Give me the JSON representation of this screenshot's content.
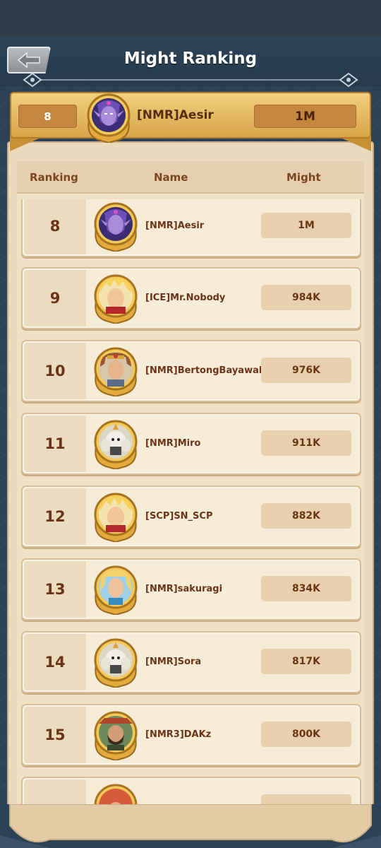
{
  "header": {
    "title": "Might Ranking",
    "back_icon": "arrow-left-icon"
  },
  "self": {
    "rank": "8",
    "name": "[NMR]Aesir",
    "might": "1M",
    "avatar": "elf-sorceress-avatar"
  },
  "columns": {
    "ranking": "Ranking",
    "name": "Name",
    "might": "Might"
  },
  "rows": [
    {
      "rank": "8",
      "name": "[NMR]Aesir",
      "might": "1M",
      "avatar": "elf-sorceress-avatar"
    },
    {
      "rank": "9",
      "name": "[ICE]Mr.Nobody",
      "might": "984K",
      "avatar": "blond-hero-avatar"
    },
    {
      "rank": "10",
      "name": "[NMR]BertongBayawak",
      "might": "976K",
      "avatar": "warrior-king-avatar"
    },
    {
      "rank": "11",
      "name": "[NMR]Miro",
      "might": "911K",
      "avatar": "white-knight-avatar"
    },
    {
      "rank": "12",
      "name": "[SCP]SN_SCP",
      "might": "882K",
      "avatar": "blond-hero-avatar"
    },
    {
      "rank": "13",
      "name": "[NMR]sakuragi",
      "might": "834K",
      "avatar": "long-hair-hero-avatar"
    },
    {
      "rank": "14",
      "name": "[NMR]Sora",
      "might": "817K",
      "avatar": "white-knight-avatar"
    },
    {
      "rank": "15",
      "name": "[NMR3]DAKz",
      "might": "800K",
      "avatar": "bearded-ranger-avatar"
    },
    {
      "rank": "",
      "name": "",
      "might": "",
      "avatar": "red-hat-avatar"
    }
  ],
  "colors": {
    "background": "#2b4155",
    "gold": "#d9a549",
    "paper": "#ead9bd",
    "text_brown": "#6a3418"
  }
}
